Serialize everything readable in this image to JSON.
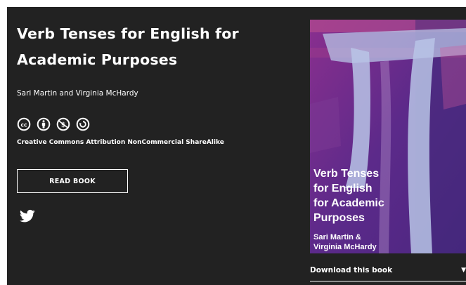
{
  "book": {
    "title": "Verb Tenses for English for Academic Purposes",
    "authors": "Sari Martin and Virginia McHardy"
  },
  "license": {
    "icons": [
      "cc-icon",
      "attribution-icon",
      "noncommercial-icon",
      "sharealike-icon"
    ],
    "text": "Creative Commons Attribution NonCommercial ShareAlike"
  },
  "actions": {
    "read_label": "READ BOOK",
    "share_icon": "twitter-icon",
    "download_label": "Download this book",
    "download_caret": "▼"
  },
  "cover": {
    "title": "Verb Tenses\nfor English\nfor Academic\nPurposes",
    "authors": "Sari Martin &\nVirginia McHardy"
  },
  "colors": {
    "background": "#222222",
    "text": "#ffffff",
    "cover_purple": "#6a2a86",
    "cover_accent": "#b8c4e6"
  }
}
